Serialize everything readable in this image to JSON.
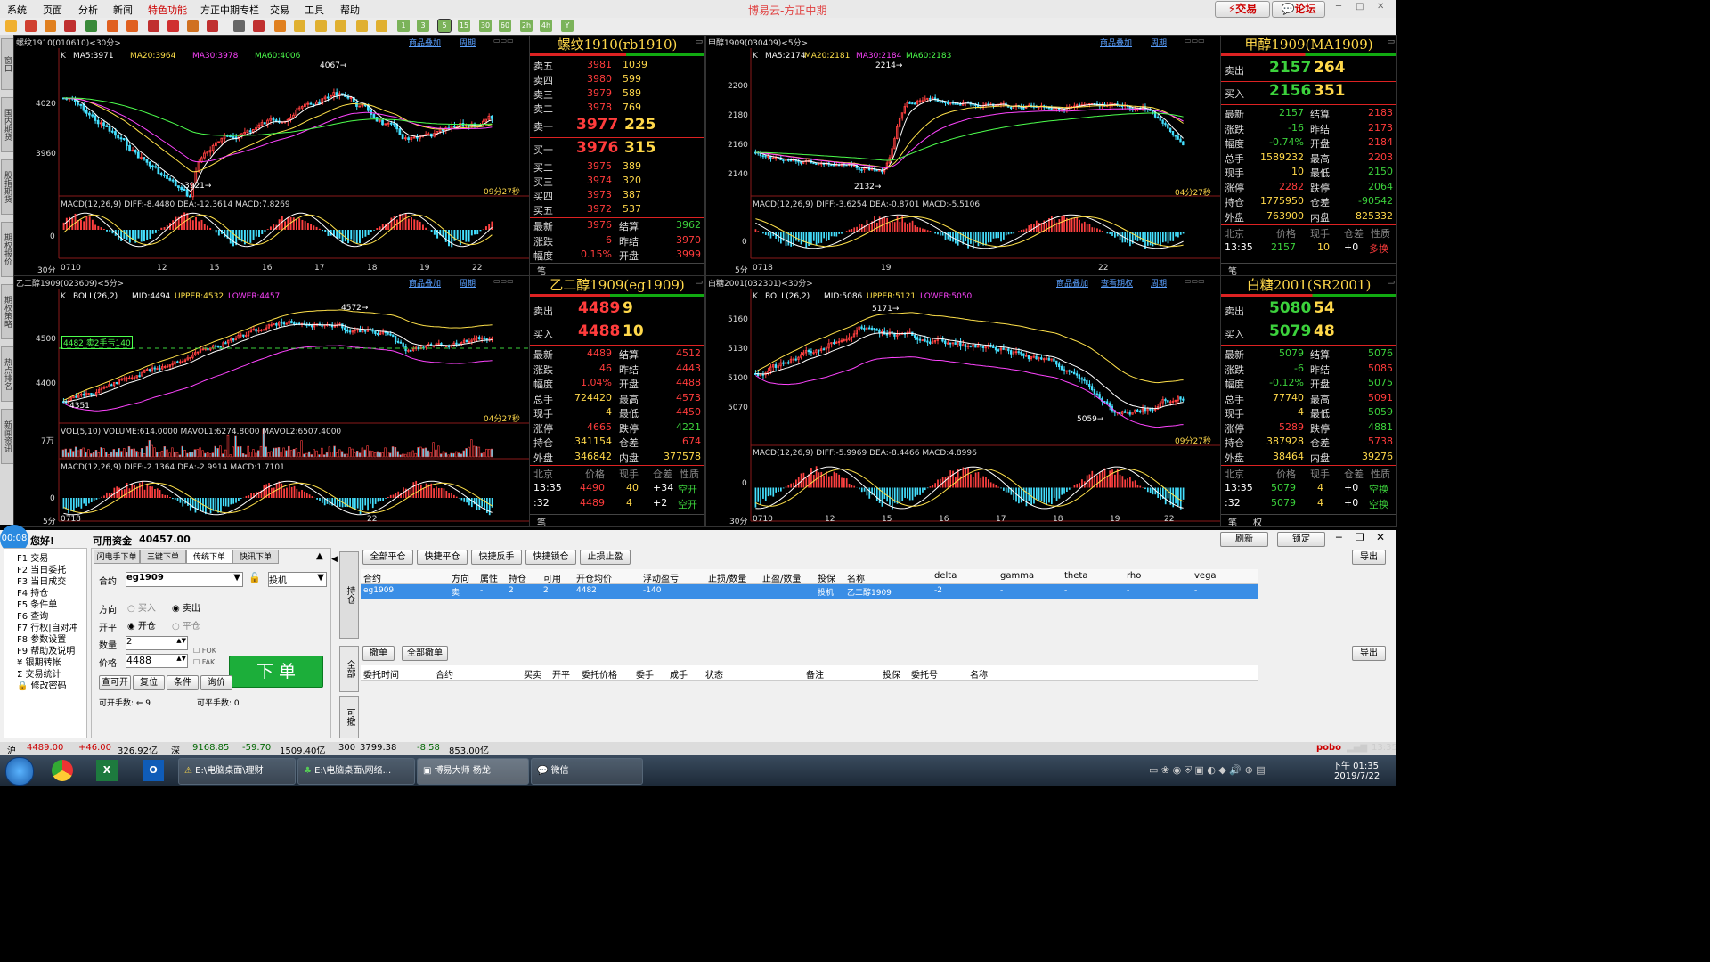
{
  "menu": {
    "items": [
      "系统",
      "页面",
      "分析",
      "新闻",
      "特色功能",
      "方正中期专栏",
      "交易",
      "工具",
      "帮助"
    ]
  },
  "app_title": "博易云-方正中期",
  "top_buttons": {
    "trade": "交易",
    "forum": "论坛"
  },
  "toolbar_nums": [
    "1",
    "3",
    "5",
    "15",
    "30",
    "60",
    "2h",
    "4h",
    "Y"
  ],
  "left_tabs": [
    "窗口",
    "国内期货",
    "股指期货",
    "期权报价",
    "期权策略",
    "热点排名",
    "新闻资讯"
  ],
  "charts": {
    "rb": {
      "title": "螺纹1910(010610)<30分>",
      "links": [
        "商品叠加",
        "周期"
      ],
      "ma": {
        "k": "K",
        "ma5": "MA5:3971",
        "ma20": "MA20:3964",
        "ma30": "MA30:3978",
        "ma60": "MA60:4006"
      },
      "yticks": [
        "4020",
        "3960"
      ],
      "hi": "4067→",
      "lo": "3921→",
      "timer": "09分27秒",
      "macd": "MACD(12,26,9) DIFF:-8.4480 DEA:-12.3614 MACD:7.8269",
      "macd_zero": "0",
      "period": "30分",
      "xlabels": [
        "0710",
        "12",
        "15",
        "16",
        "17",
        "18",
        "19",
        "22"
      ]
    },
    "ma": {
      "title": "甲醇1909(030409)<5分>",
      "links": [
        "商品叠加",
        "周期"
      ],
      "ma": {
        "k": "K",
        "ma5": "MA5:2174",
        "ma20": "MA20:2181",
        "ma30": "MA30:2184",
        "ma60": "MA60:2183"
      },
      "yticks": [
        "2200",
        "2180",
        "2160",
        "2140"
      ],
      "hi": "2214→",
      "lo": "2132→",
      "timer": "04分27秒",
      "macd": "MACD(12,26,9) DIFF:-3.6254 DEA:-0.8701 MACD:-5.5106",
      "macd_zero": "0",
      "period": "5分",
      "xlabels": [
        "0718",
        "19",
        "22"
      ]
    },
    "eg": {
      "title": "乙二醇1909(023609)<5分>",
      "links": [
        "商品叠加",
        "周期"
      ],
      "boll": {
        "k": "K",
        "name": "BOLL(26,2)",
        "mid": "MID:4494",
        "upper": "UPPER:4532",
        "lower": "LOWER:4457"
      },
      "yticks": [
        "4500",
        "4400"
      ],
      "hi": "4572→",
      "lo": "4351",
      "position_tag": "4482 卖2手亏140",
      "timer": "04分27秒",
      "vol": "VOL(5,10) VOLUME:614.0000 MAVOL1:6274.8000 MAVOL2:6507.4000",
      "vol_unit": "7万",
      "macd": "MACD(12,26,9) DIFF:-2.1364 DEA:-2.9914 MACD:1.7101",
      "macd_zero": "0",
      "period": "5分",
      "xlabels": [
        "0718",
        "22"
      ]
    },
    "sr": {
      "title": "白糖2001(032301)<30分>",
      "links": [
        "商品叠加",
        "查看期权",
        "周期"
      ],
      "boll": {
        "k": "K",
        "name": "BOLL(26,2)",
        "mid": "MID:5086",
        "upper": "UPPER:5121",
        "lower": "LOWER:5050"
      },
      "yticks": [
        "5160",
        "5130",
        "5100",
        "5070"
      ],
      "hi": "5171→",
      "lo": "5059→",
      "timer": "09分27秒",
      "macd": "MACD(12,26,9) DIFF:-5.9969 DEA:-8.4466 MACD:4.8996",
      "macd_zero": "0",
      "period": "30分",
      "xlabels": [
        "0710",
        "12",
        "15",
        "16",
        "17",
        "18",
        "19",
        "22"
      ]
    }
  },
  "quotes": {
    "rb": {
      "title": "螺纹1910(rb1910)",
      "asks": [
        [
          "卖五",
          "3981",
          "1039"
        ],
        [
          "卖四",
          "3980",
          "599"
        ],
        [
          "卖三",
          "3979",
          "589"
        ],
        [
          "卖二",
          "3978",
          "769"
        ],
        [
          "卖一",
          "3977",
          "225"
        ]
      ],
      "bids": [
        [
          "买一",
          "3976",
          "315"
        ],
        [
          "买二",
          "3975",
          "389"
        ],
        [
          "买三",
          "3974",
          "320"
        ],
        [
          "买四",
          "3973",
          "387"
        ],
        [
          "买五",
          "3972",
          "537"
        ]
      ],
      "stats": [
        [
          "最新",
          "3976",
          "结算",
          "3962"
        ],
        [
          "涨跌",
          "6",
          "昨结",
          "3970"
        ],
        [
          "幅度",
          "0.15%",
          "开盘",
          "3999"
        ]
      ],
      "foot": "笔"
    },
    "ma": {
      "title": "甲醇1909(MA1909)",
      "sell": [
        "卖出",
        "2157",
        "264"
      ],
      "buy": [
        "买入",
        "2156",
        "351"
      ],
      "stats": [
        [
          "最新",
          "2157",
          "结算",
          "2183"
        ],
        [
          "涨跌",
          "-16",
          "昨结",
          "2173"
        ],
        [
          "幅度",
          "-0.74%",
          "开盘",
          "2184"
        ],
        [
          "总手",
          "1589232",
          "最高",
          "2203"
        ],
        [
          "现手",
          "10",
          "最低",
          "2150"
        ],
        [
          "涨停",
          "2282",
          "跌停",
          "2064"
        ],
        [
          "持仓",
          "1775950",
          "仓差",
          "-90542"
        ],
        [
          "外盘",
          "763900",
          "内盘",
          "825332"
        ]
      ],
      "tick_head": [
        "北京",
        "价格",
        "现手",
        "仓差",
        "性质"
      ],
      "ticks": [
        [
          "13:35",
          "2157",
          "10",
          "+0",
          "多换"
        ]
      ],
      "foot": "笔"
    },
    "eg": {
      "title": "乙二醇1909(eg1909)",
      "sell": [
        "卖出",
        "4489",
        "9"
      ],
      "buy": [
        "买入",
        "4488",
        "10"
      ],
      "stats": [
        [
          "最新",
          "4489",
          "结算",
          "4512"
        ],
        [
          "涨跌",
          "46",
          "昨结",
          "4443"
        ],
        [
          "幅度",
          "1.04%",
          "开盘",
          "4488"
        ],
        [
          "总手",
          "724420",
          "最高",
          "4573"
        ],
        [
          "现手",
          "4",
          "最低",
          "4450"
        ],
        [
          "涨停",
          "4665",
          "跌停",
          "4221"
        ],
        [
          "持仓",
          "341154",
          "仓差",
          "674"
        ],
        [
          "外盘",
          "346842",
          "内盘",
          "377578"
        ]
      ],
      "tick_head": [
        "北京",
        "价格",
        "现手",
        "仓差",
        "性质"
      ],
      "ticks": [
        [
          "13:35",
          "4490",
          "40",
          "+34",
          "空开"
        ],
        [
          ":32",
          "4489",
          "4",
          "+2",
          "空开"
        ]
      ],
      "foot": "笔"
    },
    "sr": {
      "title": "白糖2001(SR2001)",
      "sell": [
        "卖出",
        "5080",
        "54"
      ],
      "buy": [
        "买入",
        "5079",
        "48"
      ],
      "stats": [
        [
          "最新",
          "5079",
          "结算",
          "5076"
        ],
        [
          "涨跌",
          "-6",
          "昨结",
          "5085"
        ],
        [
          "幅度",
          "-0.12%",
          "开盘",
          "5075"
        ],
        [
          "总手",
          "77740",
          "最高",
          "5091"
        ],
        [
          "现手",
          "4",
          "最低",
          "5059"
        ],
        [
          "涨停",
          "5289",
          "跌停",
          "4881"
        ],
        [
          "持仓",
          "387928",
          "仓差",
          "5738"
        ],
        [
          "外盘",
          "38464",
          "内盘",
          "39276"
        ]
      ],
      "tick_head": [
        "北京",
        "价格",
        "现手",
        "仓差",
        "性质"
      ],
      "ticks": [
        [
          "13:35",
          "5079",
          "4",
          "+0",
          "空换"
        ],
        [
          ":32",
          "5079",
          "4",
          "+0",
          "空换"
        ]
      ],
      "foot": "笔",
      "foot2": "权"
    }
  },
  "trade": {
    "clock": "00:08",
    "greeting": "您好!",
    "funds_label": "可用资金",
    "funds_value": "40457.00",
    "refresh": "刷新",
    "lock": "锁定",
    "nav": [
      "F1 交易",
      "F2 当日委托",
      "F3 当日成交",
      "F4 持仓",
      "F5 条件单",
      "F6 查询",
      "F7 行权|自对冲",
      "F8 参数设置",
      "F9 帮助及说明",
      "¥ 银期转帐",
      "Σ 交易统计",
      "🔒 修改密码"
    ],
    "order_tabs": [
      "闪电手下单",
      "三键下单",
      "传统下单",
      "快讯下单"
    ],
    "contract_label": "合约",
    "contract_value": "eg1909",
    "hedge_value": "投机",
    "dir_label": "方向",
    "dir_buy": "买入",
    "dir_sell": "卖出",
    "oc_label": "开平",
    "oc_open": "开仓",
    "oc_close": "平仓",
    "qty_label": "数量",
    "qty_value": "2",
    "price_label": "价格",
    "price_value": "4488",
    "fok": "FOK",
    "fak": "FAK",
    "submit": "下 单",
    "small_btns": [
      "查可开",
      "复位",
      "条件",
      "询价"
    ],
    "can_open": "可开手数: ⇐ 9",
    "can_close": "可平手数: 0",
    "side_tabs": [
      "持仓",
      "全部",
      "可撤"
    ],
    "pos_btns": [
      "全部平仓",
      "快捷平仓",
      "快捷反手",
      "快捷锁仓",
      "止损止盈"
    ],
    "export": "导出",
    "pos_cols": [
      "合约",
      "方向",
      "属性",
      "持仓",
      "可用",
      "开仓均价",
      "浮动盈亏",
      "止损/数量",
      "止盈/数量",
      "投保",
      "名称",
      "delta",
      "gamma",
      "theta",
      "rho",
      "vega"
    ],
    "pos_row": [
      "eg1909",
      "卖",
      "-",
      "2",
      "2",
      "4482",
      "-140",
      "",
      "",
      "投机",
      "乙二醇1909",
      "-2",
      "-",
      "-",
      "-",
      "-"
    ],
    "ord_btns": [
      "撤单",
      "全部撤单"
    ],
    "ord_cols": [
      "委托时间",
      "合约",
      "买卖",
      "开平",
      "委托价格",
      "委手",
      "成手",
      "状态",
      "备注",
      "投保",
      "委托号",
      "名称"
    ]
  },
  "status": {
    "items": [
      "沪",
      "4489.00",
      "+46.00",
      "326.92亿",
      "深",
      "9168.85",
      "-59.70",
      "1509.40亿",
      "300",
      "3799.38",
      "-8.58",
      "853.00亿"
    ],
    "brand": "pobo",
    "time": "13:35"
  },
  "taskbar": {
    "tasks": [
      "E:\\电脑桌面\\理财",
      "E:\\电脑桌面\\网络...",
      "博易大师 杨龙",
      "微信"
    ],
    "clock_time": "下午 01:35",
    "clock_date": "2019/7/22"
  }
}
